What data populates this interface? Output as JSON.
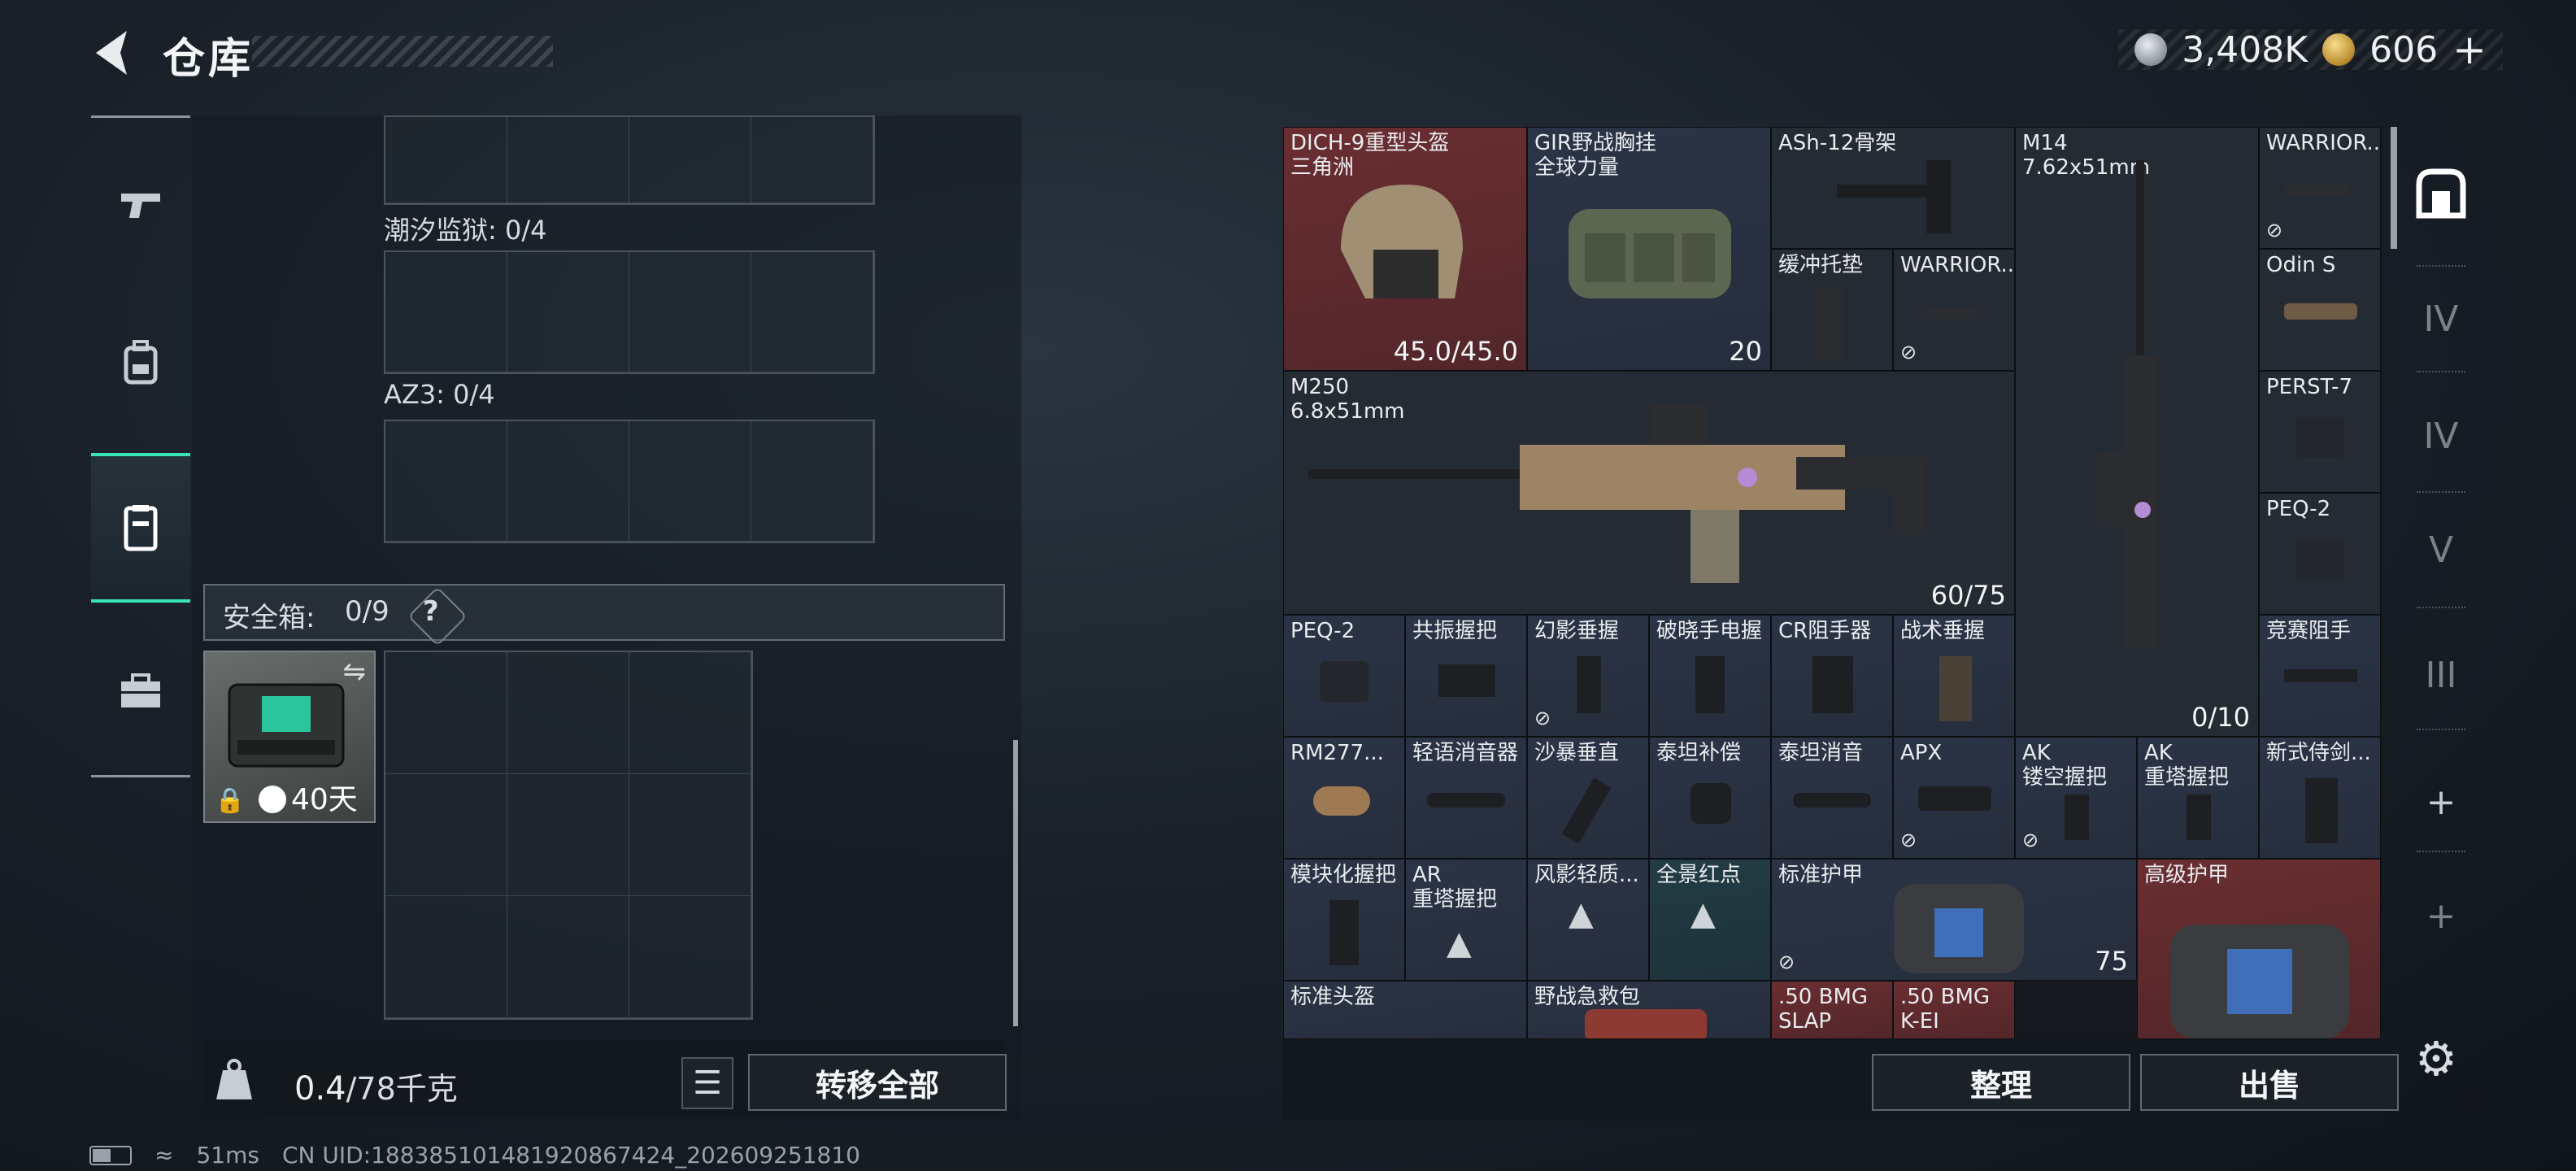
{
  "header": {
    "title": "仓库",
    "silver": "3,408K",
    "gold": "606",
    "plus": "+"
  },
  "left": {
    "containers": [
      {
        "label": "潮汐监狱: 0/4"
      },
      {
        "label": "AZ3: 0/4"
      }
    ],
    "safe": {
      "label": "安全箱:",
      "count": "0/9",
      "help": "?",
      "timer": "40天"
    },
    "weight": {
      "current": "0.4",
      "max": "/78千克"
    },
    "transfer_all": "转移全部"
  },
  "stash": {
    "items": [
      {
        "id": "dich9",
        "name": "DICH-9重型头盔",
        "sub": "三角洲",
        "count": "45.0/45.0"
      },
      {
        "id": "gir",
        "name": "GIR野战胸挂",
        "sub": "全球力量",
        "count": "20"
      },
      {
        "id": "ash12",
        "name": "ASh-12骨架"
      },
      {
        "id": "m14",
        "name": "M14",
        "sub": "7.62x51mm",
        "count": "0/10"
      },
      {
        "id": "warrior1",
        "name": "WARRIOR..."
      },
      {
        "id": "buffer",
        "name": "缓冲托垫"
      },
      {
        "id": "warrior2",
        "name": "WARRIOR..."
      },
      {
        "id": "odins",
        "name": "Odin S"
      },
      {
        "id": "m250",
        "name": "M250",
        "sub": "6.8x51mm",
        "count": "60/75"
      },
      {
        "id": "perst7",
        "name": "PERST-7"
      },
      {
        "id": "peq2a",
        "name": "PEQ-2"
      },
      {
        "id": "peq2b",
        "name": "PEQ-2"
      },
      {
        "id": "resonant",
        "name": "共振握把"
      },
      {
        "id": "phantom",
        "name": "幻影垂握"
      },
      {
        "id": "dawn",
        "name": "破晓手电握"
      },
      {
        "id": "cr",
        "name": "CR阻手器"
      },
      {
        "id": "tactical",
        "name": "战术垂握"
      },
      {
        "id": "race",
        "name": "竞赛阻手"
      },
      {
        "id": "rm277",
        "name": "RM277..."
      },
      {
        "id": "lightsup",
        "name": "轻语消音器"
      },
      {
        "id": "storm",
        "name": "沙暴垂直"
      },
      {
        "id": "titancomp",
        "name": "泰坦补偿"
      },
      {
        "id": "titansup",
        "name": "泰坦消音"
      },
      {
        "id": "apx",
        "name": "APX"
      },
      {
        "id": "akhollow",
        "name": "AK",
        "sub": "镂空握把"
      },
      {
        "id": "aktower",
        "name": "AK",
        "sub": "重塔握把"
      },
      {
        "id": "newstyle",
        "name": "新式侍剑..."
      },
      {
        "id": "modgrip",
        "name": "模块化握把"
      },
      {
        "id": "artower",
        "name": "AR",
        "sub": "重塔握把"
      },
      {
        "id": "windshadow",
        "name": "风影轻质..."
      },
      {
        "id": "panoramic",
        "name": "全景红点"
      },
      {
        "id": "stdarmor",
        "name": "标准护甲",
        "count": "75"
      },
      {
        "id": "advarmor",
        "name": "高级护甲"
      },
      {
        "id": "stdhelmet",
        "name": "标准头盔"
      },
      {
        "id": "fieldkit",
        "name": "野战急救包"
      },
      {
        "id": "bmg1",
        "name": ".50 BMG",
        "sub": "SLAP"
      },
      {
        "id": "bmg2",
        "name": ".50 BMG",
        "sub": "K-EI"
      }
    ],
    "sort": "整理",
    "sell": "出售"
  },
  "rightnav": {
    "tiers": [
      "IV",
      "IV",
      "V",
      "III"
    ],
    "plus": "+"
  },
  "status": {
    "ping": "51ms",
    "uid": "CN UID:1883851014819208674​24_202609251810"
  },
  "colors": {
    "accent": "#38e4b3",
    "red_rarity": "#6a2e31",
    "blue_rarity": "#2b3446"
  },
  "icons": [
    "back-arrow-icon",
    "pistol-icon",
    "backpack-icon",
    "vest-icon",
    "briefcase-icon",
    "lock-icon",
    "clock-icon",
    "swap-icon",
    "list-icon",
    "weight-icon",
    "gear-icon",
    "plus-icon"
  ]
}
